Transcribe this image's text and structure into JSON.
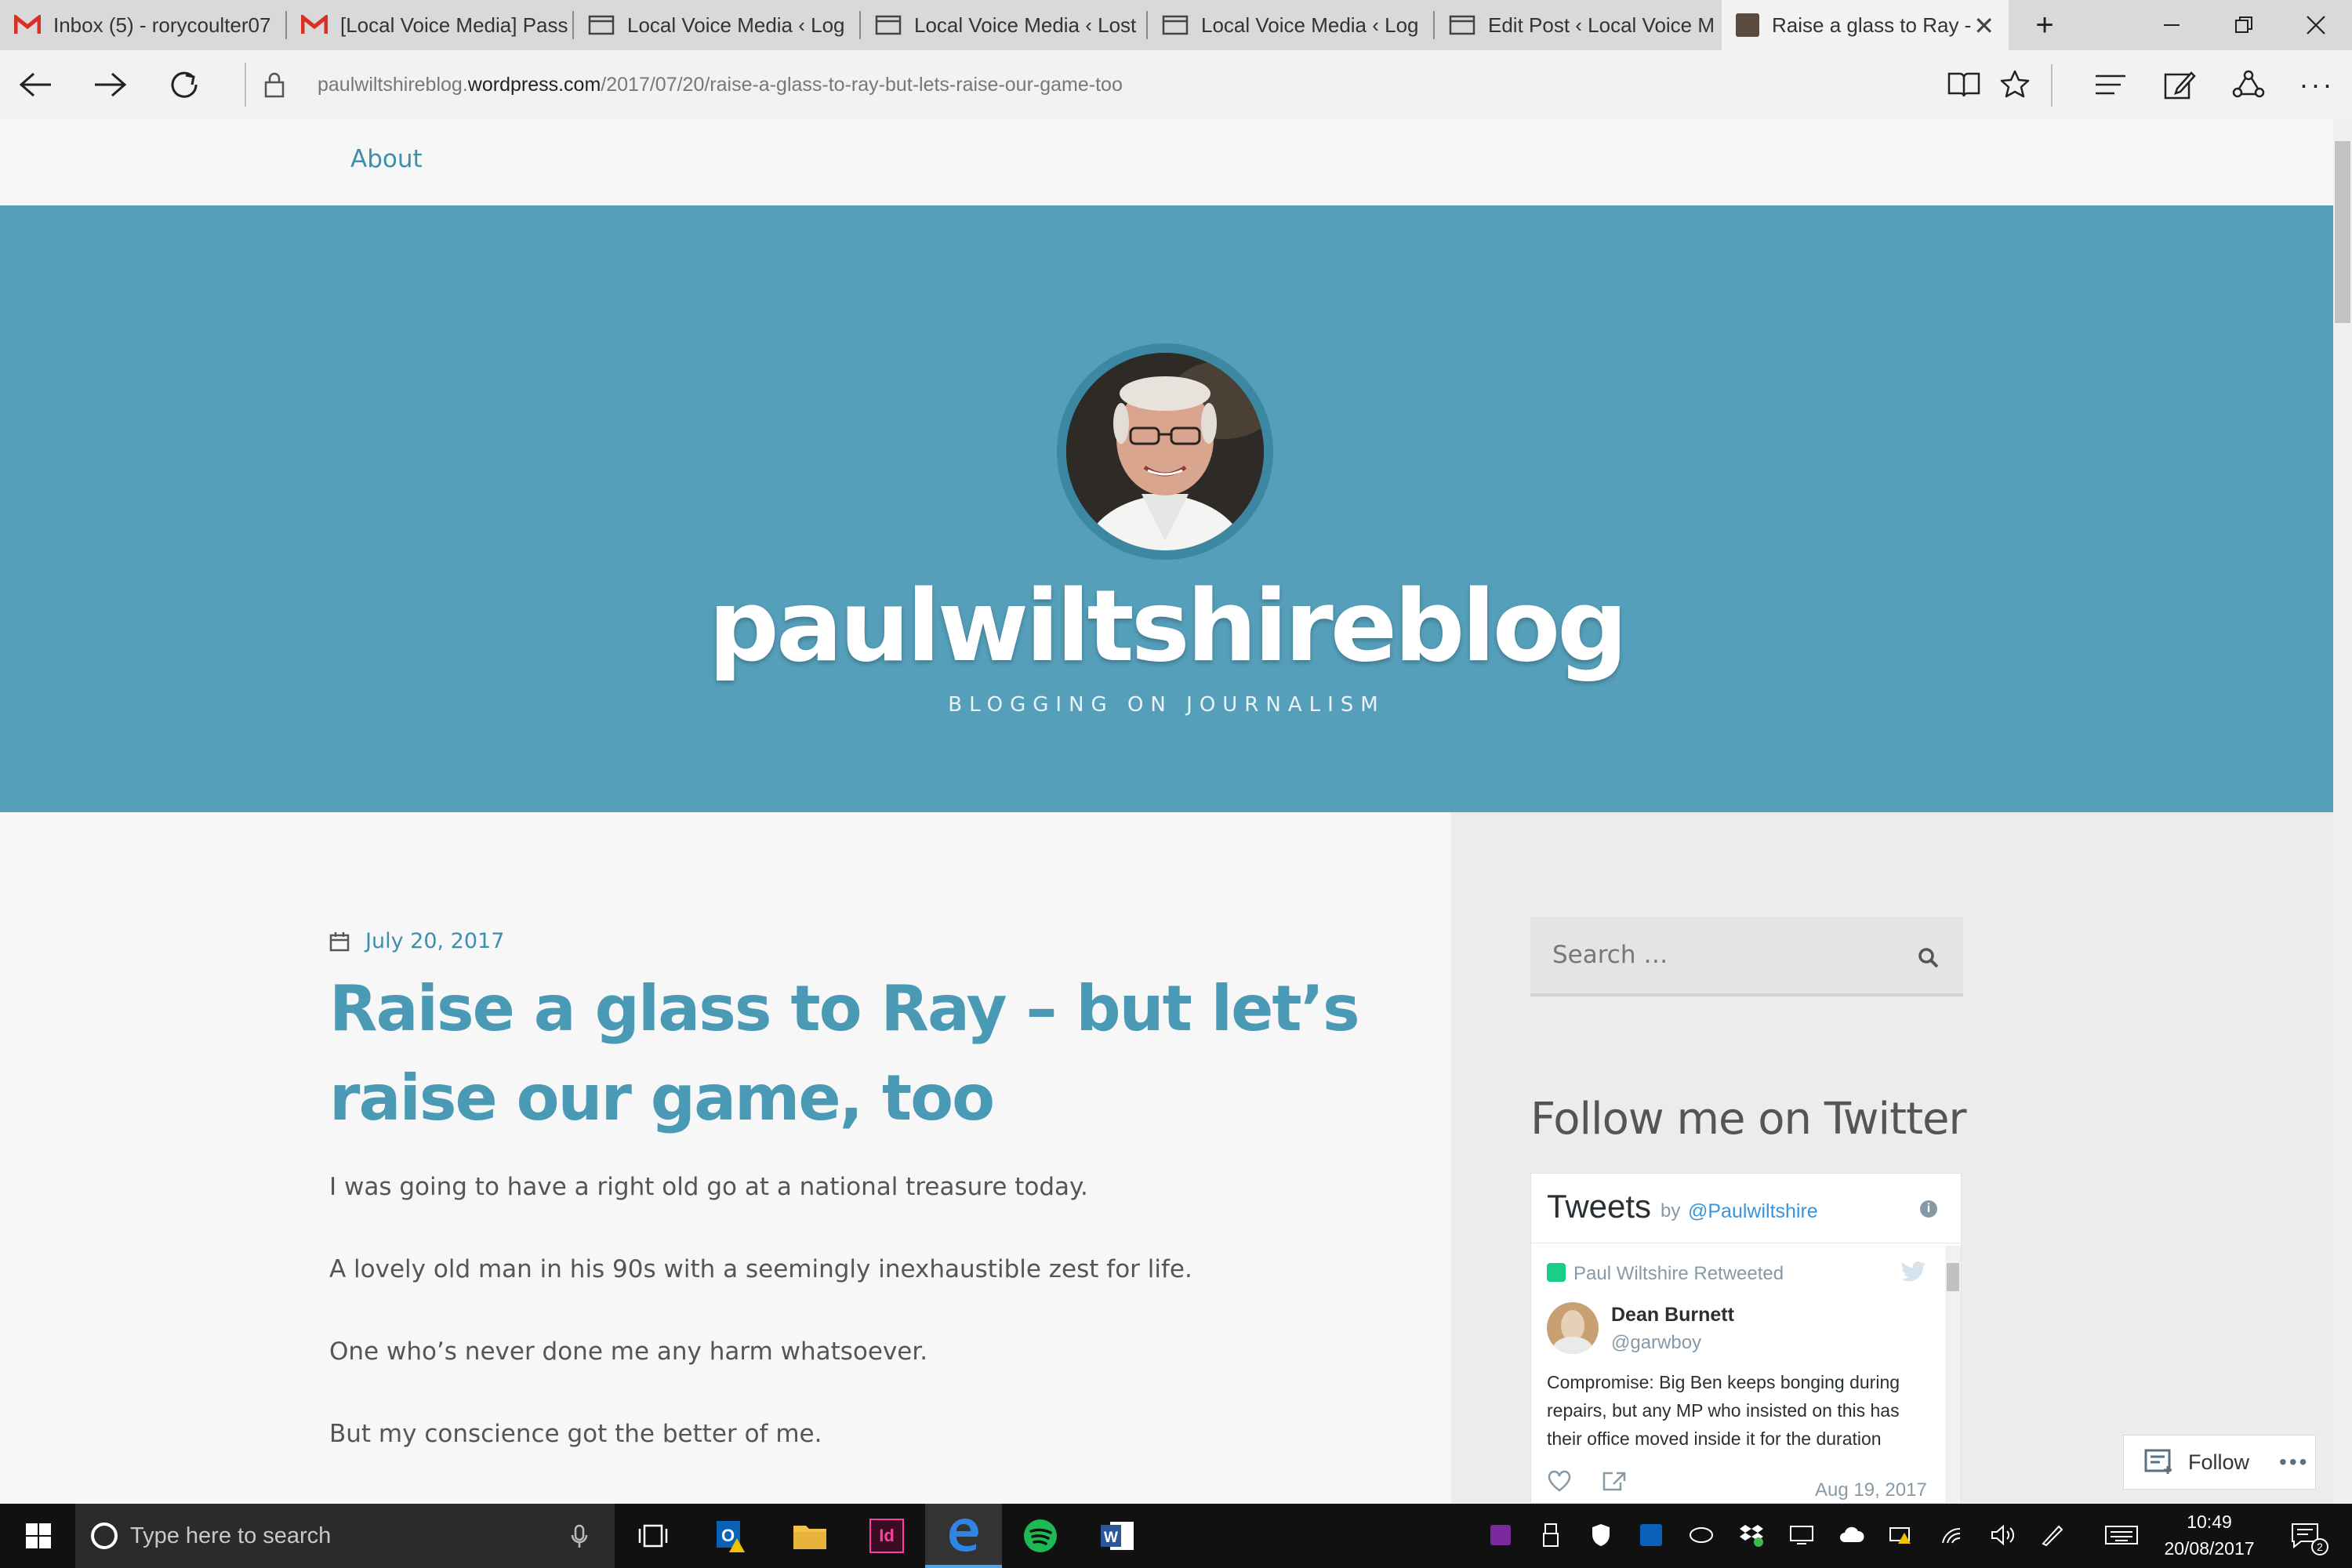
{
  "browser": {
    "tabs": [
      {
        "label": "Inbox (5) - rorycoulter07",
        "icon": "gmail-icon"
      },
      {
        "label": "[Local Voice Media] Pass",
        "icon": "gmail-icon"
      },
      {
        "label": "Local Voice Media ‹ Log",
        "icon": "page-icon"
      },
      {
        "label": "Local Voice Media ‹ Lost",
        "icon": "page-icon"
      },
      {
        "label": "Local Voice Media ‹ Log",
        "icon": "page-icon"
      },
      {
        "label": "Edit Post ‹ Local Voice M",
        "icon": "page-icon"
      },
      {
        "label": "Raise a glass to Ray -",
        "icon": "favicon-photo",
        "active": true
      }
    ],
    "url_prefix": "paulwiltshireblog.",
    "url_domain": "wordpress.com",
    "url_path": "/2017/07/20/raise-a-glass-to-ray-but-lets-raise-our-game-too"
  },
  "site": {
    "nav_about": "About",
    "title": "paulwiltshireblog",
    "tagline": "BLOGGING ON JOURNALISM",
    "accent": "#569fba"
  },
  "post": {
    "date": "July 20, 2017",
    "title": "Raise a glass to Ray – but let’s raise our game, too",
    "paragraphs": [
      "I was going to have a right old go at a national treasure today.",
      "A lovely old man in his 90s with a seemingly inexhaustible zest for life.",
      "One who’s never done me any harm whatsoever.",
      "But my conscience got the better of me."
    ]
  },
  "sidebar": {
    "search_placeholder": "Search …",
    "follow_heading": "Follow me on Twitter",
    "widget": {
      "title": "Tweets",
      "by": "by",
      "handle": "@Paulwiltshire",
      "retweeted_by": "Paul Wiltshire Retweeted",
      "tweet_author": "Dean Burnett",
      "tweet_handle": "@garwboy",
      "tweet_text": "Compromise: Big Ben keeps bonging during repairs, but any MP who insisted on this has their office moved inside it for the duration",
      "tweet_date": "Aug 19, 2017"
    },
    "follow_button": "Follow"
  },
  "taskbar": {
    "search_placeholder": "Type here to search",
    "time": "10:49",
    "date": "20/08/2017",
    "notification_count": "2",
    "indesign_label": "Id"
  }
}
